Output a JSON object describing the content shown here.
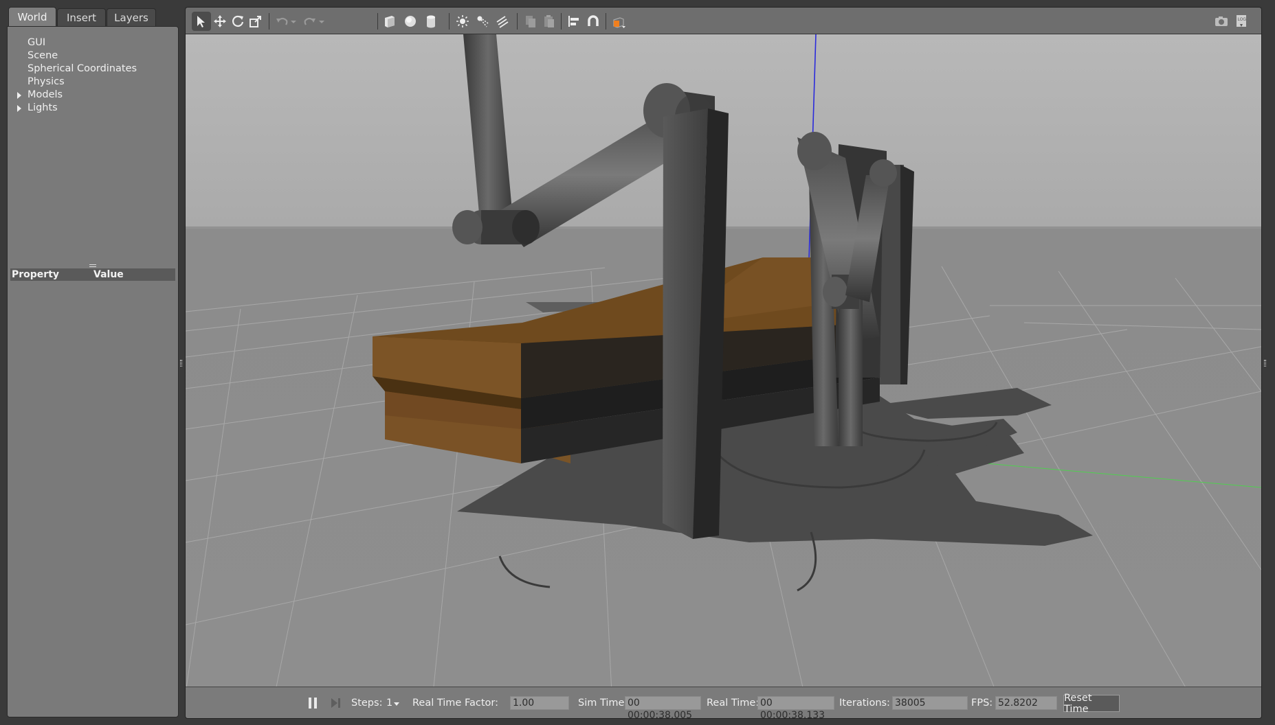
{
  "left_panel": {
    "tabs": [
      {
        "label": "World",
        "active": true
      },
      {
        "label": "Insert",
        "active": false
      },
      {
        "label": "Layers",
        "active": false
      }
    ],
    "tree_items": [
      {
        "label": "GUI",
        "expandable": false
      },
      {
        "label": "Scene",
        "expandable": false
      },
      {
        "label": "Spherical Coordinates",
        "expandable": false
      },
      {
        "label": "Physics",
        "expandable": false
      },
      {
        "label": "Models",
        "expandable": true
      },
      {
        "label": "Lights",
        "expandable": true
      }
    ],
    "property_table": {
      "property_header": "Property",
      "value_header": "Value"
    }
  },
  "toolbar": {
    "tools": [
      "select-arrow-icon",
      "translate-icon",
      "rotate-icon",
      "scale-icon",
      "undo-icon",
      "redo-icon",
      "box-icon",
      "sphere-icon",
      "cylinder-icon",
      "point-light-icon",
      "spot-light-icon",
      "directional-light-icon",
      "copy-icon",
      "paste-icon",
      "align-icon",
      "snap-icon",
      "view-angle-icon",
      "screenshot-icon",
      "log-icon"
    ],
    "accent_color": "#f07f1e"
  },
  "status_bar": {
    "steps_label": "Steps:",
    "steps_value": "1",
    "rtf_label": "Real Time Factor:",
    "rtf_value": "1.00",
    "sim_time_label": "Sim Time:",
    "sim_time_value": "00 00:00:38.005",
    "real_time_label": "Real Time:",
    "real_time_value": "00 00:00:38.133",
    "iterations_label": "Iterations:",
    "iterations_value": "38005",
    "fps_label": "FPS:",
    "fps_value": "52.8202",
    "reset_label": "Reset Time"
  },
  "scene": {
    "sky_color": "#b4b4b4",
    "ground_color": "#8d8d8d",
    "table_color": "#5a3a12",
    "robot_color": "#4e4e4e"
  }
}
